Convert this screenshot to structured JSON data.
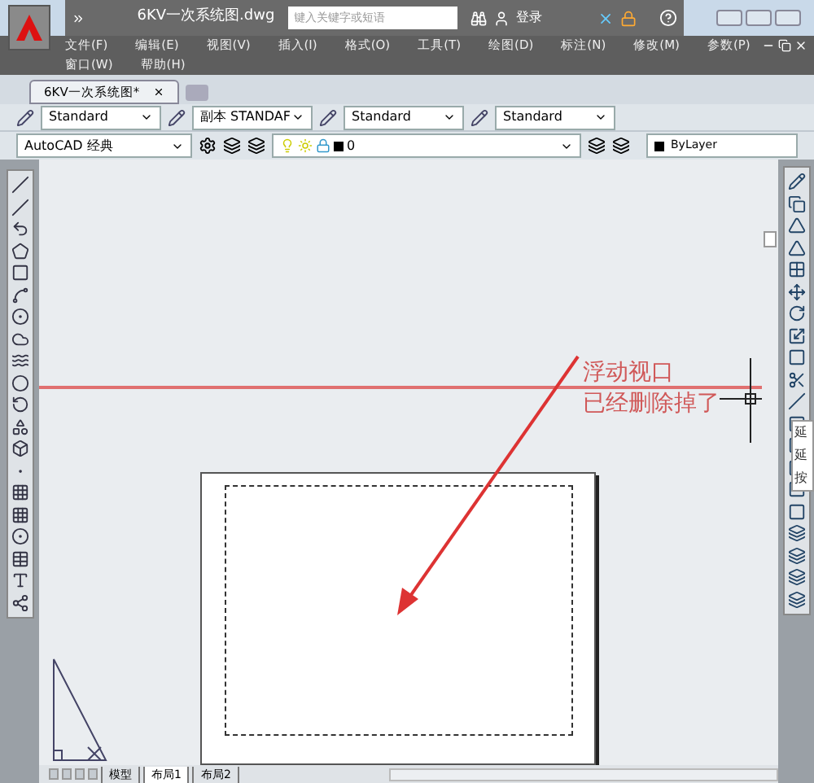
{
  "title_bar": {
    "file_name": "6KV一次系统图.dwg",
    "search": {
      "placeholder": "键入关键字或短语"
    },
    "login": "登录"
  },
  "menu_rows": [
    [
      "文件(F)",
      "编辑(E)",
      "视图(V)",
      "插入(I)",
      "格式(O)",
      "工具(T)",
      "绘图(D)",
      "标注(N)",
      "修改(M)",
      "参数(P)"
    ],
    [
      "窗口(W)",
      "帮助(H)"
    ]
  ],
  "doc_tabs": [
    {
      "label": "6KV一次系统图*",
      "selected": true
    }
  ],
  "style_toolbar": {
    "combos": [
      "Standard",
      "副本 STANDAF",
      "Standard",
      "Standard"
    ]
  },
  "layer_toolbar": {
    "workspace": "AutoCAD 经典",
    "layer": "0",
    "color_setting": "ByLayer"
  },
  "flyout": {
    "lines": [
      "延",
      "延",
      "按"
    ]
  },
  "annotation": {
    "lines": [
      "浮动视口",
      "已经删除掉了"
    ]
  },
  "layout_tabs": [
    {
      "label": "模型",
      "selected": false
    },
    {
      "label": "布局1",
      "selected": true
    },
    {
      "label": "布局2",
      "selected": false
    }
  ]
}
